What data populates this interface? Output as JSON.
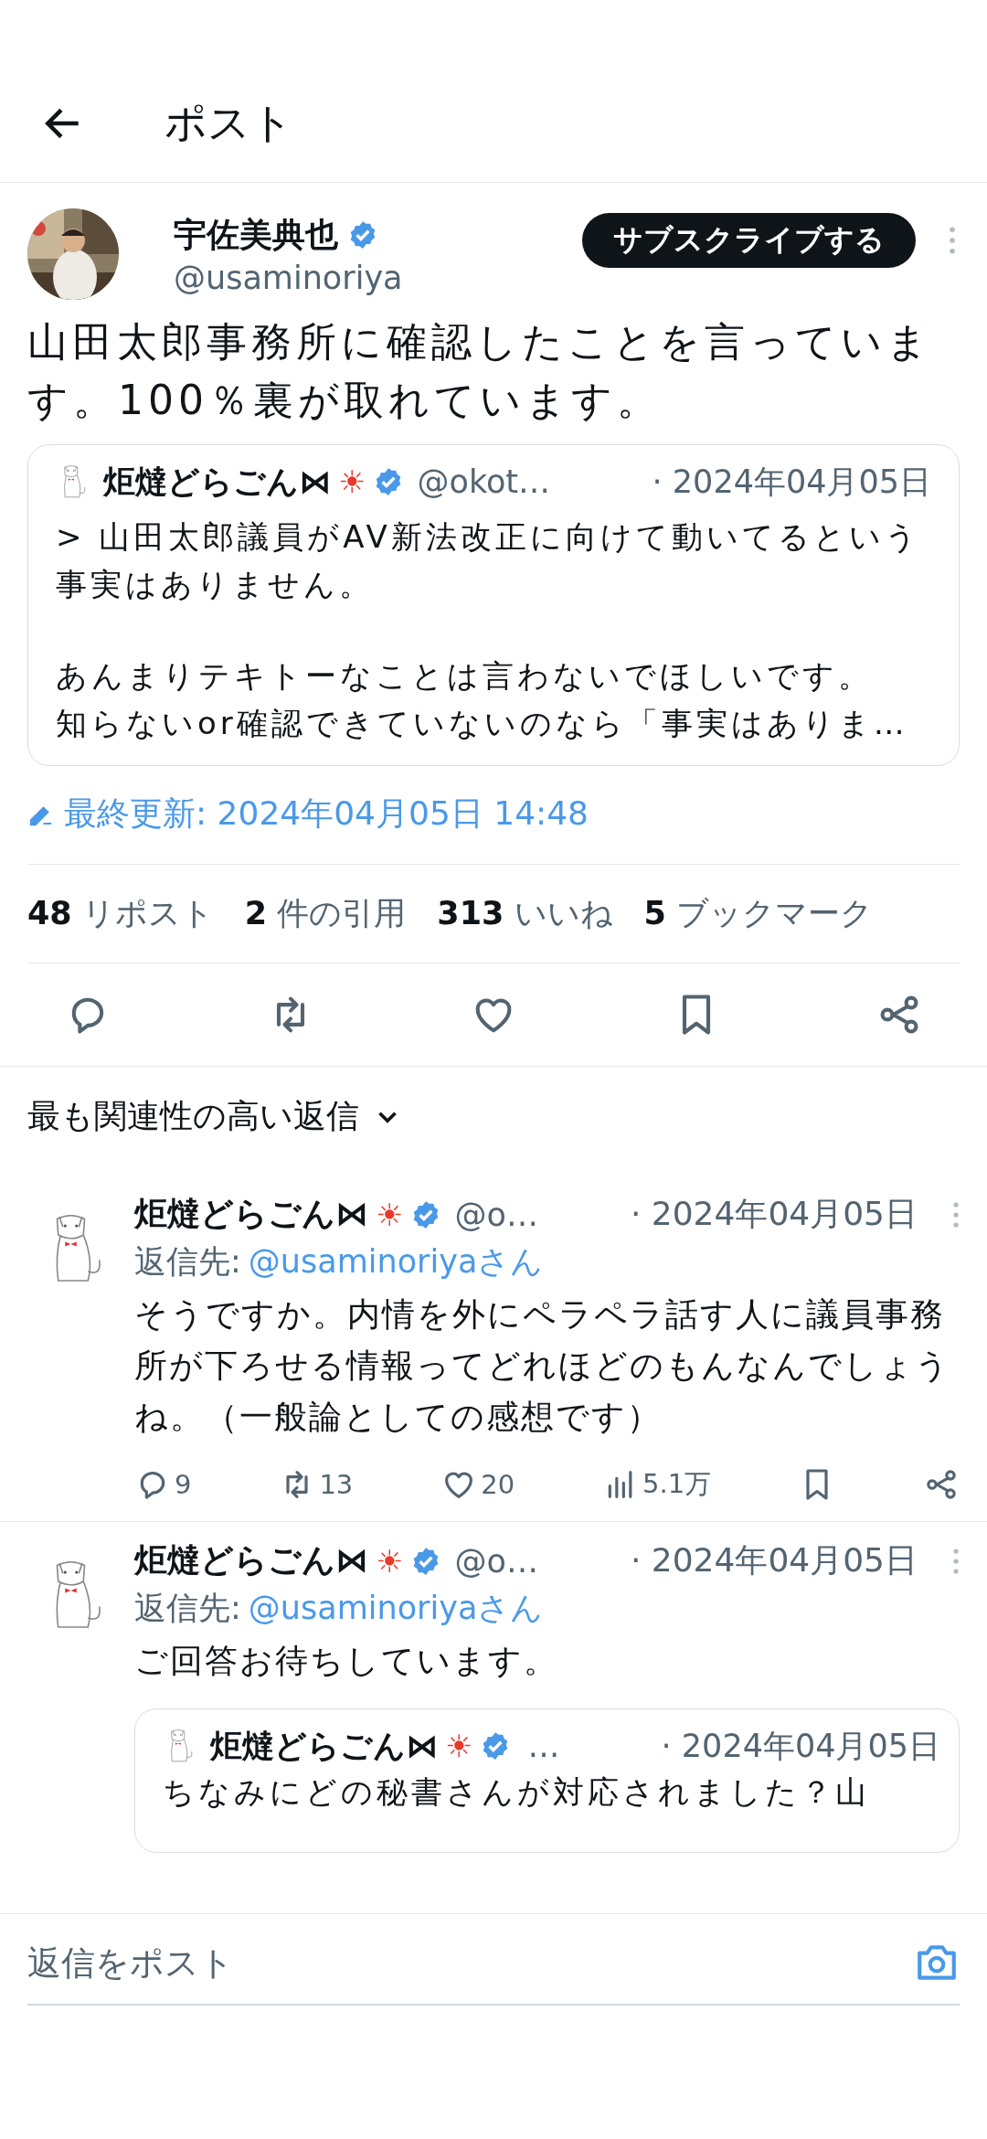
{
  "header": {
    "title": "ポスト"
  },
  "post": {
    "author": {
      "name": "宇佐美典也",
      "handle": "@usaminoriya",
      "verified": true
    },
    "subscribe_button": "サブスクライブする",
    "text": "山田太郎事務所に確認したことを言っています。100％裏が取れています。",
    "quote": {
      "name": "炬燵どらごん⋈",
      "name_emoji": "☀",
      "verified": true,
      "handle": "@okot…",
      "date": "· 2024年04月05日",
      "paragraphs": [
        [
          "> 山田太郎議員がAV新法改正に向けて動いてるという事実はありません。"
        ],
        [
          "あんまりテキトーなことは言わないでほしいです。",
          "知らないor確認できていないのなら「事実はありま…"
        ]
      ]
    },
    "edited": "最終更新: 2024年04月05日 14:48",
    "stats": [
      {
        "count": "48",
        "label": "リポスト"
      },
      {
        "count": "2",
        "label": "件の引用"
      },
      {
        "count": "313",
        "label": "いいね"
      },
      {
        "count": "5",
        "label": "ブックマーク"
      }
    ],
    "actions": [
      {
        "kind": "reply"
      },
      {
        "kind": "repost"
      },
      {
        "kind": "like"
      },
      {
        "kind": "bookmark"
      },
      {
        "kind": "share"
      }
    ]
  },
  "replies_sort": "最も関連性の高い返信",
  "replies": [
    {
      "name": "炬燵どらごん⋈",
      "name_emoji": "☀",
      "verified": true,
      "handle": "@o…",
      "date": "· 2024年04月05日",
      "reply_to_label": "返信先:",
      "reply_to": "@usaminoriyaさん",
      "text": "そうですか。内情を外にペラペラ話す人に議員事務所が下ろせる情報ってどれほどのもんなんでしょうね。（一般論としての感想です）",
      "actions": [
        {
          "kind": "reply",
          "count": "9"
        },
        {
          "kind": "repost",
          "count": "13"
        },
        {
          "kind": "like",
          "count": "20"
        },
        {
          "kind": "views",
          "count": "5.1万"
        },
        {
          "kind": "bookmark"
        },
        {
          "kind": "share"
        }
      ]
    },
    {
      "name": "炬燵どらごん⋈",
      "name_emoji": "☀",
      "verified": true,
      "handle": "@o…",
      "date": "· 2024年04月05日",
      "reply_to_label": "返信先:",
      "reply_to": "@usaminoriyaさん",
      "text": "ご回答お待ちしています。",
      "quote": {
        "name": "炬燵どらごん⋈",
        "name_emoji": "☀",
        "verified": true,
        "handle": "…",
        "date": "· 2024年04月05日",
        "text": "ちなみにどの秘書さんが対応されました？山"
      }
    }
  ],
  "composer": {
    "placeholder": "返信をポスト"
  }
}
